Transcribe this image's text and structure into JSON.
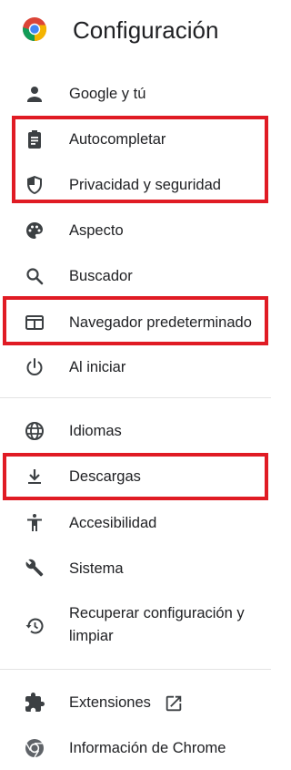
{
  "header": {
    "title": "Configuración",
    "logo_icon": "chrome-logo-icon"
  },
  "menu": {
    "items": [
      {
        "id": "google",
        "label": "Google y tú",
        "icon": "person-icon"
      },
      {
        "id": "autofill",
        "label": "Autocompletar",
        "icon": "clipboard-icon"
      },
      {
        "id": "privacy",
        "label": "Privacidad y seguridad",
        "icon": "shield-icon"
      },
      {
        "id": "appearance",
        "label": "Aspecto",
        "icon": "palette-icon"
      },
      {
        "id": "search",
        "label": "Buscador",
        "icon": "search-icon"
      },
      {
        "id": "default-browser",
        "label": "Navegador predeterminado",
        "icon": "browser-window-icon"
      },
      {
        "id": "on-startup",
        "label": "Al iniciar",
        "icon": "power-icon"
      },
      {
        "id": "languages",
        "label": "Idiomas",
        "icon": "globe-icon"
      },
      {
        "id": "downloads",
        "label": "Descargas",
        "icon": "download-icon"
      },
      {
        "id": "accessibility",
        "label": "Accesibilidad",
        "icon": "accessibility-icon"
      },
      {
        "id": "system",
        "label": "Sistema",
        "icon": "wrench-icon"
      },
      {
        "id": "reset",
        "label": "Recuperar configuración y limpiar",
        "icon": "restore-icon"
      },
      {
        "id": "extensions",
        "label": "Extensiones",
        "icon": "puzzle-icon"
      },
      {
        "id": "about",
        "label": "Información de Chrome",
        "icon": "chrome-icon"
      }
    ]
  },
  "highlight_color": "#e01b24",
  "icon_color": "#3c4043"
}
